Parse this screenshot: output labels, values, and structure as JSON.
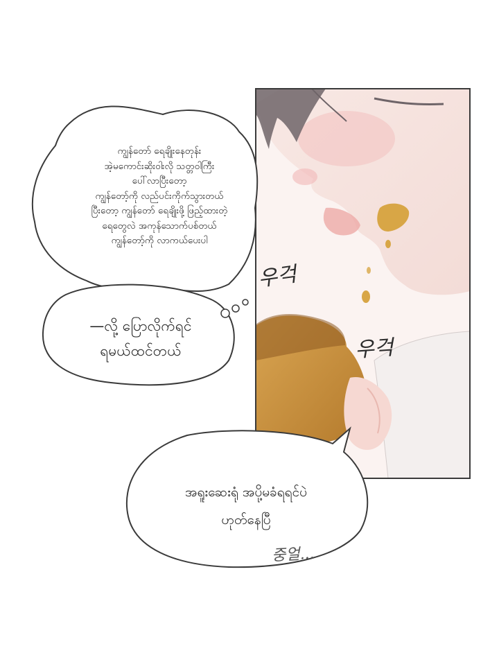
{
  "panel": {
    "description_none": ""
  },
  "bubbles": {
    "thought": {
      "lines": [
        "ကျွန်တော် ရေချိုးနေတုန်း",
        "အဲ့မကောင်းဆိုးဝါးလို သတ္တဝါကြီး",
        "ပေါ်လာပြီးတော့",
        "ကျွန်တော့်ကို လည်ပင်းကိုက်သွားတယ်",
        "ပြီးတော့ ကျွန်တော် ရေချိုးဖို့ ဖြည့်ထားတဲ့",
        "ရေတွေလဲ အကုန်သောက်ပစ်တယ်",
        "ကျွန်တော့်ကို လာကယ်ပေးပါ"
      ]
    },
    "thought_small": {
      "lines": [
        "—လို့ ပြောလိုက်ရင်",
        "ရမယ်ထင်တယ်"
      ]
    },
    "speech": {
      "lines": [
        "အရူးဆေးရုံ အပို့မခံရရင်ပဲ",
        "ဟုတ်နေပြီ"
      ]
    }
  },
  "sfx": {
    "first": "우걱",
    "second": "우걱",
    "mumble": "중얼..."
  },
  "colors": {
    "skin": "#f6e3df",
    "blush": "#f2b8b8",
    "hair": "#6e6468",
    "bread": "#c8943c",
    "sauce": "#d8a646"
  }
}
